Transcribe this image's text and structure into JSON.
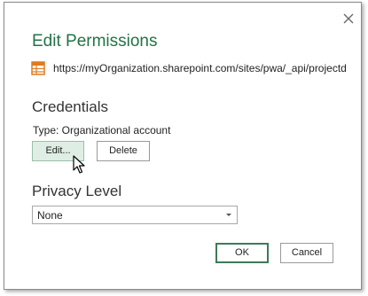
{
  "dialog": {
    "title": "Edit Permissions",
    "url": "https://myOrganization.sharepoint.com/sites/pwa/_api/projectd",
    "close_icon": "close-icon",
    "source_icon": "table-icon"
  },
  "credentials": {
    "heading": "Credentials",
    "type_label": "Type: Organizational account",
    "edit_label": "Edit...",
    "delete_label": "Delete"
  },
  "privacy": {
    "heading": "Privacy Level",
    "selected": "None"
  },
  "footer": {
    "ok_label": "OK",
    "cancel_label": "Cancel"
  },
  "colors": {
    "title": "#217346",
    "edit_button_bg": "#dfeee4",
    "ok_border": "#3d7a58",
    "source_icon": "#e07a1f"
  }
}
